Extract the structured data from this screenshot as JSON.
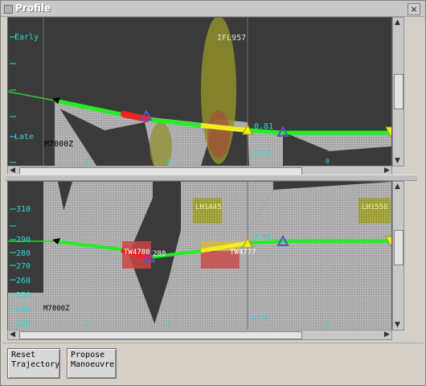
{
  "window": {
    "title": "Profile",
    "close_glyph": "×"
  },
  "top_panel": {
    "y_labels": [
      "Early",
      "Late"
    ],
    "flight_labels": [
      "IFL957",
      "M7000Z"
    ],
    "value_label": "0.81",
    "time_label": "10:15",
    "tick_marks": [
      "0",
      "0",
      "0",
      "0",
      "0"
    ]
  },
  "bottom_panel": {
    "y_labels": [
      "310",
      "290",
      "280",
      "270",
      "260",
      "250",
      "240",
      "220"
    ],
    "flight_labels": [
      "M7000Z",
      "LH1445",
      "LH1550",
      "TW4780",
      "TW4777"
    ],
    "value_labels": [
      "280",
      "0.81"
    ],
    "time_label": "10:15",
    "tick_marks": [
      "0",
      "0",
      "0",
      "0"
    ]
  },
  "buttons": {
    "reset": [
      "Reset",
      "Trajectory"
    ],
    "propose": [
      "Propose",
      "Manoeuvre"
    ]
  },
  "colors": {
    "trajectory": "#22ee22",
    "conflict_red": "#ee2222",
    "highlight_yellow": "#eeee22",
    "marker_blue": "#5555cc",
    "label_cyan": "#22dddd",
    "background": "#3a3a3a"
  }
}
